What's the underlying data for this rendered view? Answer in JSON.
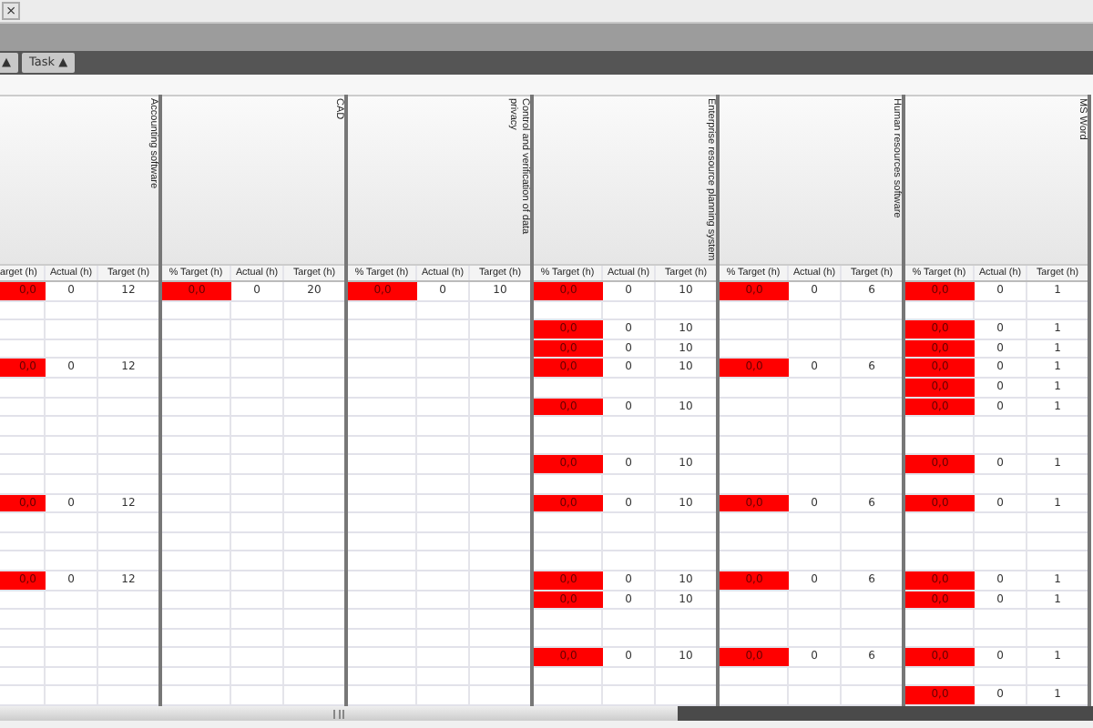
{
  "toolbar": {
    "close_button": "×"
  },
  "tabs": [
    {
      "label": "▲",
      "selected": false
    },
    {
      "label": "Task ▲",
      "selected": false
    }
  ],
  "groups": [
    {
      "title": "Accounting software",
      "columns": [
        "arget (h)",
        "Actual (h)",
        "Target (h)"
      ],
      "rows": [
        {
          "percent": "0,0",
          "actual": "0",
          "target": "12"
        },
        null,
        null,
        null,
        {
          "percent": "0,0",
          "actual": "0",
          "target": "12"
        },
        null,
        null,
        null,
        null,
        null,
        null,
        {
          "percent": "0,0",
          "actual": "0",
          "target": "12"
        },
        null,
        null,
        null,
        {
          "percent": "0,0",
          "actual": "0",
          "target": "12"
        },
        null,
        null,
        null,
        null,
        null,
        null
      ]
    },
    {
      "title": "CAD",
      "columns": [
        "% Target (h)",
        "Actual (h)",
        "Target (h)"
      ],
      "rows": [
        {
          "percent": "0,0",
          "actual": "0",
          "target": "20"
        },
        null,
        null,
        null,
        null,
        null,
        null,
        null,
        null,
        null,
        null,
        null,
        null,
        null,
        null,
        null,
        null,
        null,
        null,
        null,
        null,
        null
      ]
    },
    {
      "title": "Control and verification of data privacy",
      "columns": [
        "% Target (h)",
        "Actual (h)",
        "Target (h)"
      ],
      "rows": [
        {
          "percent": "0,0",
          "actual": "0",
          "target": "10"
        },
        null,
        null,
        null,
        null,
        null,
        null,
        null,
        null,
        null,
        null,
        null,
        null,
        null,
        null,
        null,
        null,
        null,
        null,
        null,
        null,
        null
      ]
    },
    {
      "title": "Enterprise resource planning system",
      "columns": [
        "% Target (h)",
        "Actual (h)",
        "Target (h)"
      ],
      "rows": [
        {
          "percent": "0,0",
          "actual": "0",
          "target": "10"
        },
        null,
        {
          "percent": "0,0",
          "actual": "0",
          "target": "10"
        },
        {
          "percent": "0,0",
          "actual": "0",
          "target": "10"
        },
        {
          "percent": "0,0",
          "actual": "0",
          "target": "10"
        },
        null,
        {
          "percent": "0,0",
          "actual": "0",
          "target": "10"
        },
        null,
        null,
        {
          "percent": "0,0",
          "actual": "0",
          "target": "10"
        },
        null,
        {
          "percent": "0,0",
          "actual": "0",
          "target": "10"
        },
        null,
        null,
        null,
        {
          "percent": "0,0",
          "actual": "0",
          "target": "10"
        },
        {
          "percent": "0,0",
          "actual": "0",
          "target": "10"
        },
        null,
        null,
        {
          "percent": "0,0",
          "actual": "0",
          "target": "10"
        },
        null,
        null
      ]
    },
    {
      "title": "Human resources software",
      "columns": [
        "% Target (h)",
        "Actual (h)",
        "Target (h)"
      ],
      "rows": [
        {
          "percent": "0,0",
          "actual": "0",
          "target": "6"
        },
        null,
        null,
        null,
        {
          "percent": "0,0",
          "actual": "0",
          "target": "6"
        },
        null,
        null,
        null,
        null,
        null,
        null,
        {
          "percent": "0,0",
          "actual": "0",
          "target": "6"
        },
        null,
        null,
        null,
        {
          "percent": "0,0",
          "actual": "0",
          "target": "6"
        },
        null,
        null,
        null,
        {
          "percent": "0,0",
          "actual": "0",
          "target": "6"
        },
        null,
        null
      ]
    },
    {
      "title": "MS Word",
      "columns": [
        "% Target (h)",
        "Actual (h)",
        "Target (h)"
      ],
      "rows": [
        {
          "percent": "0,0",
          "actual": "0",
          "target": "1"
        },
        null,
        {
          "percent": "0,0",
          "actual": "0",
          "target": "1"
        },
        {
          "percent": "0,0",
          "actual": "0",
          "target": "1"
        },
        {
          "percent": "0,0",
          "actual": "0",
          "target": "1"
        },
        {
          "percent": "0,0",
          "actual": "0",
          "target": "1"
        },
        {
          "percent": "0,0",
          "actual": "0",
          "target": "1"
        },
        null,
        null,
        {
          "percent": "0,0",
          "actual": "0",
          "target": "1"
        },
        null,
        {
          "percent": "0,0",
          "actual": "0",
          "target": "1"
        },
        null,
        null,
        null,
        {
          "percent": "0,0",
          "actual": "0",
          "target": "1"
        },
        {
          "percent": "0,0",
          "actual": "0",
          "target": "1"
        },
        null,
        null,
        {
          "percent": "0,0",
          "actual": "0",
          "target": "1"
        },
        null,
        {
          "percent": "0,0",
          "actual": "0",
          "target": "1"
        }
      ]
    }
  ]
}
